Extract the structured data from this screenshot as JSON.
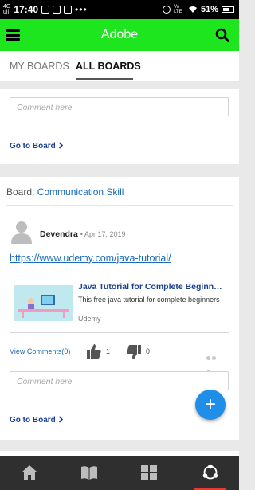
{
  "status_bar": {
    "network_top": "4G",
    "network_bottom": "ull",
    "time": "17:40",
    "volte_label": "Vo LTE",
    "battery": "51%"
  },
  "app_bar": {
    "title": "Adobe",
    "background": "#1ee61e",
    "menu_icon": "hamburger-menu-icon",
    "search_icon": "search-icon"
  },
  "tabs": [
    {
      "label": "MY BOARDS",
      "active": false
    },
    {
      "label": "ALL BOARDS",
      "active": true
    }
  ],
  "first_card": {
    "comment_placeholder": "Comment here",
    "goto_label": "Go to Board"
  },
  "second_card": {
    "board_prefix": "Board:",
    "board_name": "Communication Skill",
    "post": {
      "author": "Devendra",
      "date": "• Apr 17, 2019",
      "url": "https://www.udemy.com/java-tutorial/",
      "preview": {
        "title": "Java Tutorial for Complete Beginners",
        "description": "This free java tutorial for complete beginners",
        "site": "Udemy"
      },
      "view_comments": "View Comments(0)",
      "likes": "1",
      "dislikes": "0"
    },
    "comment_placeholder": "Comment here",
    "goto_label": "Go to Board"
  },
  "fab_label": "+",
  "bottom_nav": [
    {
      "name": "home-icon"
    },
    {
      "name": "book-icon"
    },
    {
      "name": "grid-icon"
    },
    {
      "name": "share-network-icon",
      "active": true
    }
  ],
  "colors": {
    "accent_link": "#1a6bb8",
    "fab": "#1f8ee8",
    "active_indicator": "#e53935",
    "nav_background": "#2f2f2f"
  }
}
